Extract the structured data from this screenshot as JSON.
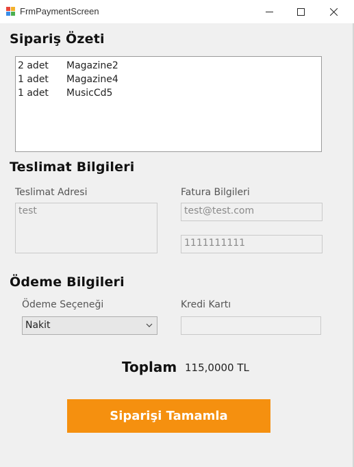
{
  "window": {
    "title": "FrmPaymentScreen"
  },
  "order_summary": {
    "title": "Sipariş Özeti",
    "items": [
      {
        "qty": "2 adet",
        "name": "Magazine2"
      },
      {
        "qty": "1 adet",
        "name": "Magazine4"
      },
      {
        "qty": "1 adet",
        "name": "MusicCd5"
      }
    ]
  },
  "delivery": {
    "title": "Teslimat Bilgileri",
    "address_label": "Teslimat Adresi",
    "address_value": "test",
    "invoice_label": "Fatura Bilgileri",
    "email_value": "test@test.com",
    "phone_value": "1111111111"
  },
  "payment": {
    "title": "Ödeme Bilgileri",
    "option_label": "Ödeme Seçeneği",
    "option_value": "Nakit",
    "card_label": "Kredi Kartı",
    "card_value": ""
  },
  "total": {
    "label": "Toplam",
    "value": "115,0000 TL"
  },
  "actions": {
    "complete_label": "Siparişi Tamamla"
  },
  "colors": {
    "accent": "#f5900f",
    "background": "#f0f0f0"
  }
}
